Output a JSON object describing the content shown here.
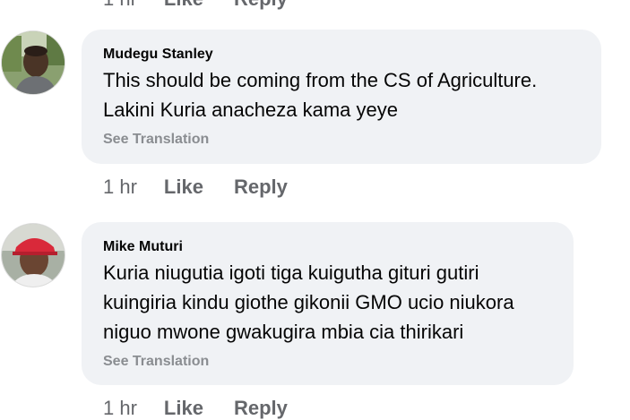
{
  "top_row": {
    "time": "1 hr",
    "like": "Like",
    "reply": "Reply"
  },
  "comments": [
    {
      "author": "Mudegu Stanley",
      "lines": [
        "This should be coming from the CS of Agriculture.",
        "Lakini Kuria anacheza kama yeye"
      ],
      "see_translation": "See Translation",
      "time": "1 hr",
      "like": "Like",
      "reply": "Reply"
    },
    {
      "author": "Mike Muturi",
      "lines": [
        "Kuria niugutia igoti tiga kuigutha gituri gutiri",
        "kuingiria kindu giothe gikonii GMO ucio niukora",
        "niguo mwone gwakugira mbia cia thirikari"
      ],
      "see_translation": "See Translation",
      "time": "1 hr",
      "like": "Like",
      "reply": "Reply"
    }
  ]
}
